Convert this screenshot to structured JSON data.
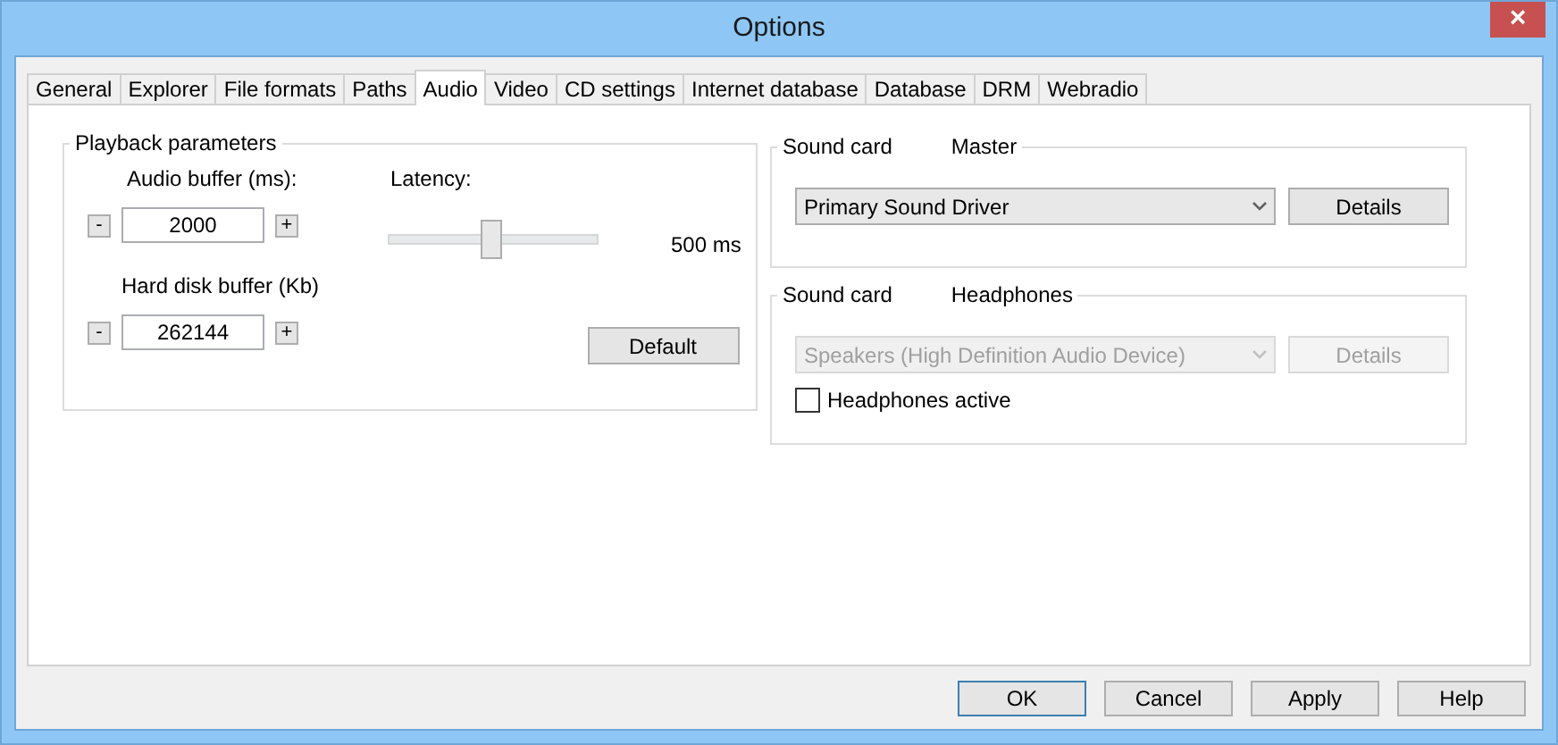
{
  "window": {
    "title": "Options",
    "close": "×"
  },
  "tabs": [
    {
      "label": "General",
      "selected": false
    },
    {
      "label": "Explorer",
      "selected": false
    },
    {
      "label": "File formats",
      "selected": false
    },
    {
      "label": "Paths",
      "selected": false
    },
    {
      "label": "Audio",
      "selected": true
    },
    {
      "label": "Video",
      "selected": false
    },
    {
      "label": "CD settings",
      "selected": false
    },
    {
      "label": "Internet database",
      "selected": false
    },
    {
      "label": "Database",
      "selected": false
    },
    {
      "label": "DRM",
      "selected": false
    },
    {
      "label": "Webradio",
      "selected": false
    }
  ],
  "playback": {
    "title": "Playback parameters",
    "audio_buffer": {
      "label": "Audio buffer (ms):",
      "value": "2000",
      "minus": "-",
      "plus": "+"
    },
    "latency": {
      "label": "Latency:",
      "level": 0.49,
      "reading": "500 ms"
    },
    "disk_buffer": {
      "label": "Hard disk buffer (Kb)",
      "value": "262144",
      "minus": "-",
      "plus": "+"
    },
    "default_button": "Default"
  },
  "sound_cards": [
    {
      "title": "Sound card",
      "role": "Master",
      "device": "Primary Sound Driver",
      "disabled": false,
      "details": "Details"
    },
    {
      "title": "Sound card",
      "role": "Headphones",
      "device": "Speakers (High Definition Audio Device)",
      "disabled": true,
      "details": "Details",
      "checkbox": {
        "label": "Headphones active",
        "checked": false
      }
    }
  ],
  "buttons": [
    {
      "label": "OK",
      "default": true
    },
    {
      "label": "Cancel",
      "default": false
    },
    {
      "label": "Apply",
      "default": false
    },
    {
      "label": "Help",
      "default": false
    }
  ]
}
